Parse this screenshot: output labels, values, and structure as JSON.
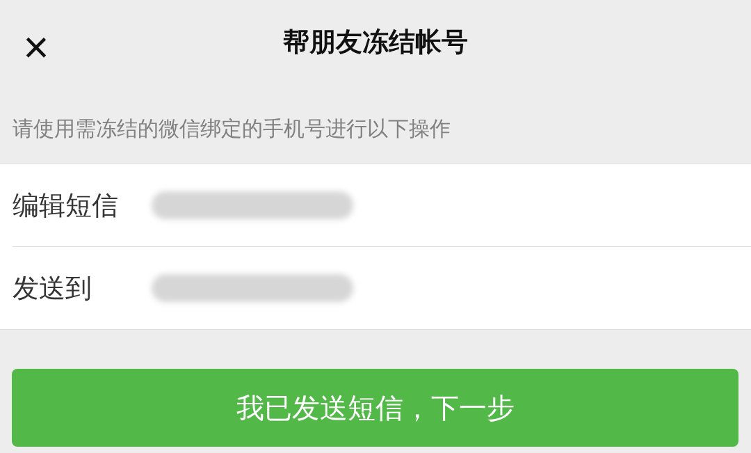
{
  "header": {
    "close": "×",
    "title": "帮朋友冻结帐号"
  },
  "hint": "请使用需冻结的微信绑定的手机号进行以下操作",
  "rows": [
    {
      "label": "编辑短信",
      "redacted": true
    },
    {
      "label": "发送到",
      "redacted": true
    }
  ],
  "button": {
    "label": "我已发送短信，下一步"
  }
}
